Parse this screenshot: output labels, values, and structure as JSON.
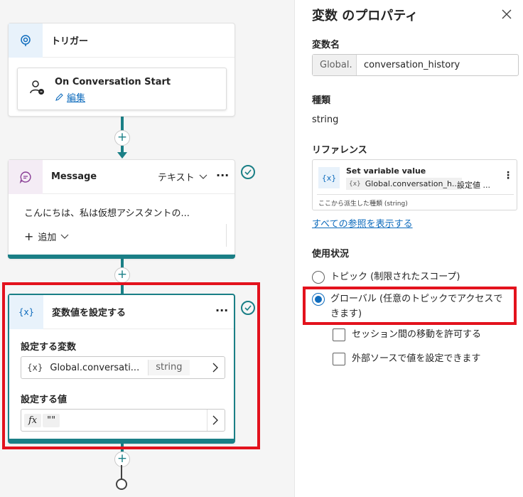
{
  "canvas": {
    "trigger": {
      "title": "トリガー",
      "card_title": "On Conversation Start",
      "edit_label": "編集"
    },
    "message": {
      "title": "Message",
      "type_label": "テキスト",
      "more": "···",
      "text": "こんにちは、私は仮想アシスタントの...",
      "add_label": "追加"
    },
    "set_variable": {
      "icon_text": "{x}",
      "title": "変数値を設定する",
      "more": "···",
      "variable_label": "設定する変数",
      "variable_icon": "{x}",
      "variable_name": "Global.conversati...",
      "variable_type": "string",
      "value_label": "設定する値",
      "value_icon": "fx",
      "value": "\"\""
    },
    "plus": "+"
  },
  "panel": {
    "title": "変数 のプロパティ",
    "name_label": "変数名",
    "name_prefix": "Global.",
    "name_value": "conversation_history",
    "type_label": "種類",
    "type_value": "string",
    "reference_label": "リファレンス",
    "reference": {
      "icon_text": "{x}",
      "title": "Set variable value",
      "chip_icon": "{x}",
      "chip_text": "Global.conversation_h...",
      "action_text": "設定値 ...",
      "more": "⋮",
      "footer": "ここから派生した種類 (string)"
    },
    "show_all_refs": "すべての参照を表示する",
    "usage_label": "使用状況",
    "usage_options": [
      {
        "label": "トピック (制限されたスコープ)",
        "selected": false
      },
      {
        "label_line1": "グローバル (任意のトピックでアクセスで",
        "label_line2": "きます)",
        "selected": true
      }
    ],
    "checkboxes": [
      {
        "label": "セッション間の移動を許可する",
        "checked": false
      },
      {
        "label": "外部ソースで値を設定できます",
        "checked": false
      }
    ]
  },
  "colors": {
    "accent_teal": "#1a7f86",
    "link_blue": "#0f6cbd",
    "highlight_red": "#e3121d"
  }
}
